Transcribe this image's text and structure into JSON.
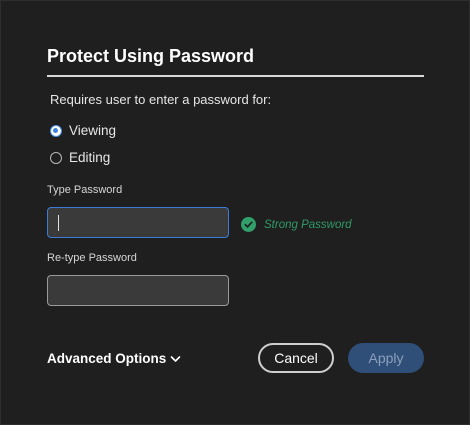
{
  "dialog": {
    "title": "Protect Using Password",
    "subtitle": "Requires user to enter a password for:"
  },
  "options": {
    "viewing_label": "Viewing",
    "editing_label": "Editing",
    "selected": "Viewing"
  },
  "fields": {
    "type_password_label": "Type Password",
    "type_password_value": "",
    "retype_password_label": "Re-type Password",
    "retype_password_value": ""
  },
  "strength": {
    "text": "Strong Password",
    "icon": "check-circle-icon",
    "color": "#31a06a"
  },
  "footer": {
    "advanced_label": "Advanced Options",
    "advanced_icon": "chevron-down-icon",
    "cancel_label": "Cancel",
    "apply_label": "Apply"
  },
  "colors": {
    "accent": "#3f82e4",
    "apply_bg": "#2f4e78",
    "background": "#1f1f1f"
  }
}
